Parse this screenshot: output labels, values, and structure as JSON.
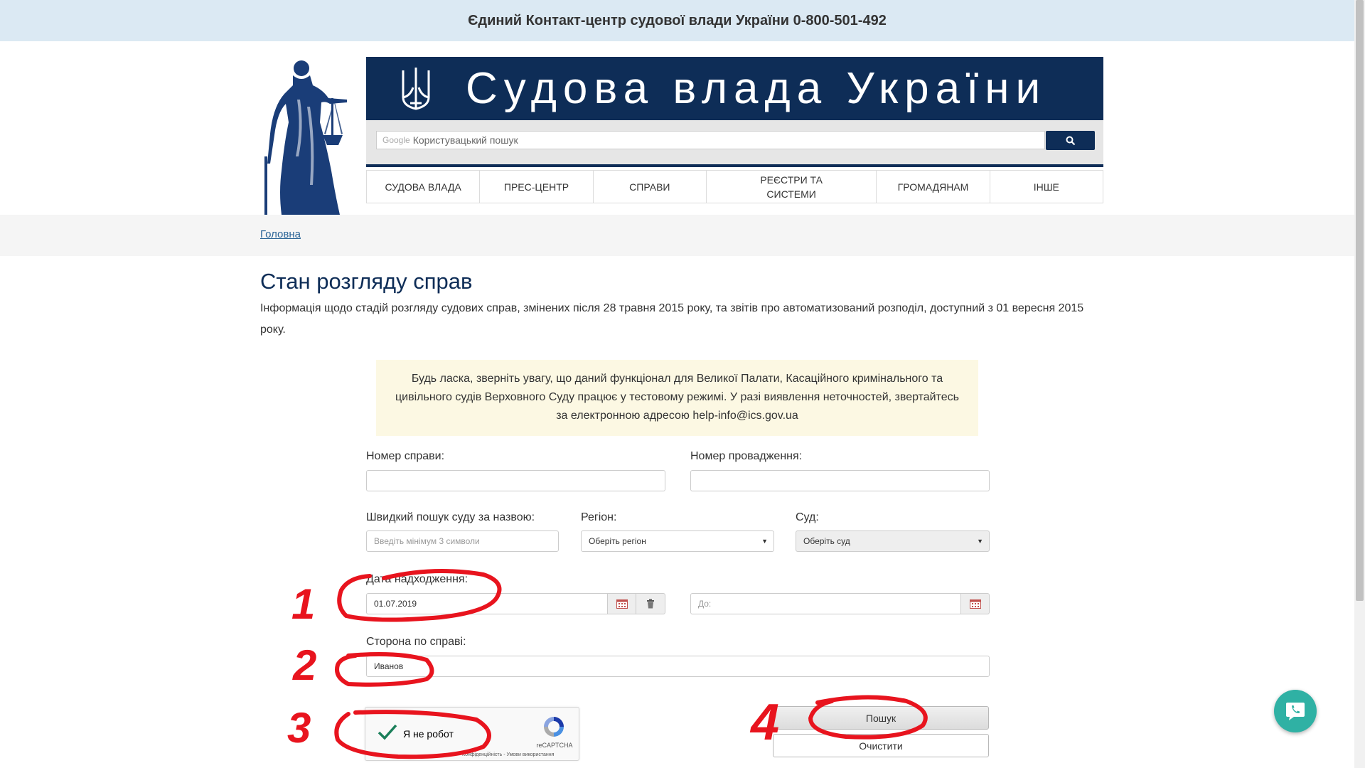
{
  "topbar": {
    "text": "Єдиний Контакт-центр судової влади України 0-800-501-492"
  },
  "header": {
    "title": "Судова влада України"
  },
  "search": {
    "brand": "Google",
    "placeholder": "Користувацький пошук"
  },
  "nav": {
    "items": [
      {
        "label": "Судова влада"
      },
      {
        "label": "Прес-центр"
      },
      {
        "label": "Справи"
      },
      {
        "label": "Реєстри та системи"
      },
      {
        "label": "Громадянам"
      },
      {
        "label": "Інше"
      }
    ]
  },
  "breadcrumb": {
    "home": "Головна"
  },
  "page": {
    "title": "Стан розгляду справ",
    "intro": "Інформація щодо стадій розгляду судових справ, змінених після 28 травня 2015 року, та звітів про автоматизований розподіл, доступний з 01 вересня 2015 року."
  },
  "notice": {
    "line1": "Будь ласка, зверніть увагу, що даний функціонал для Великої Палати, Касаційного кримінального та",
    "line2": "цивільного судів Верховного Суду працює у тестовому режимі. У разі виявлення неточностей, звертайтесь",
    "line3": "за електронною адресою help-info@ics.gov.ua"
  },
  "form": {
    "case_number_label": "Номер справи:",
    "case_number_value": "",
    "proceeding_number_label": "Номер провадження:",
    "proceeding_number_value": "",
    "quick_court_label": "Швидкий пошук суду за назвою:",
    "quick_court_placeholder": "Введіть мінімум 3 символи",
    "region_label": "Регіон:",
    "region_value": "Оберіть регіон",
    "court_label": "Суд:",
    "court_value": "Оберіть суд",
    "date_label": "Дата надходження:",
    "date_from_value": "01.07.2019",
    "date_to_placeholder": "До:",
    "party_label": "Сторона по справі:",
    "party_value": "Иванов",
    "captcha_label": "Я не робот",
    "captcha_brand": "reCAPTCHA",
    "captcha_terms": "Конфіденційність - Умови використання",
    "search_button": "Пошук",
    "clear_button": "Очистити"
  },
  "annotations": {
    "step1": "1",
    "step2": "2",
    "step3": "3",
    "step4": "4",
    "color": "#e8141e"
  },
  "colors": {
    "navy": "#0e2d57",
    "topbar": "#dbe9f3",
    "notice": "#fcf8e3",
    "chat": "#2fb1a4",
    "link": "#2a6496"
  }
}
